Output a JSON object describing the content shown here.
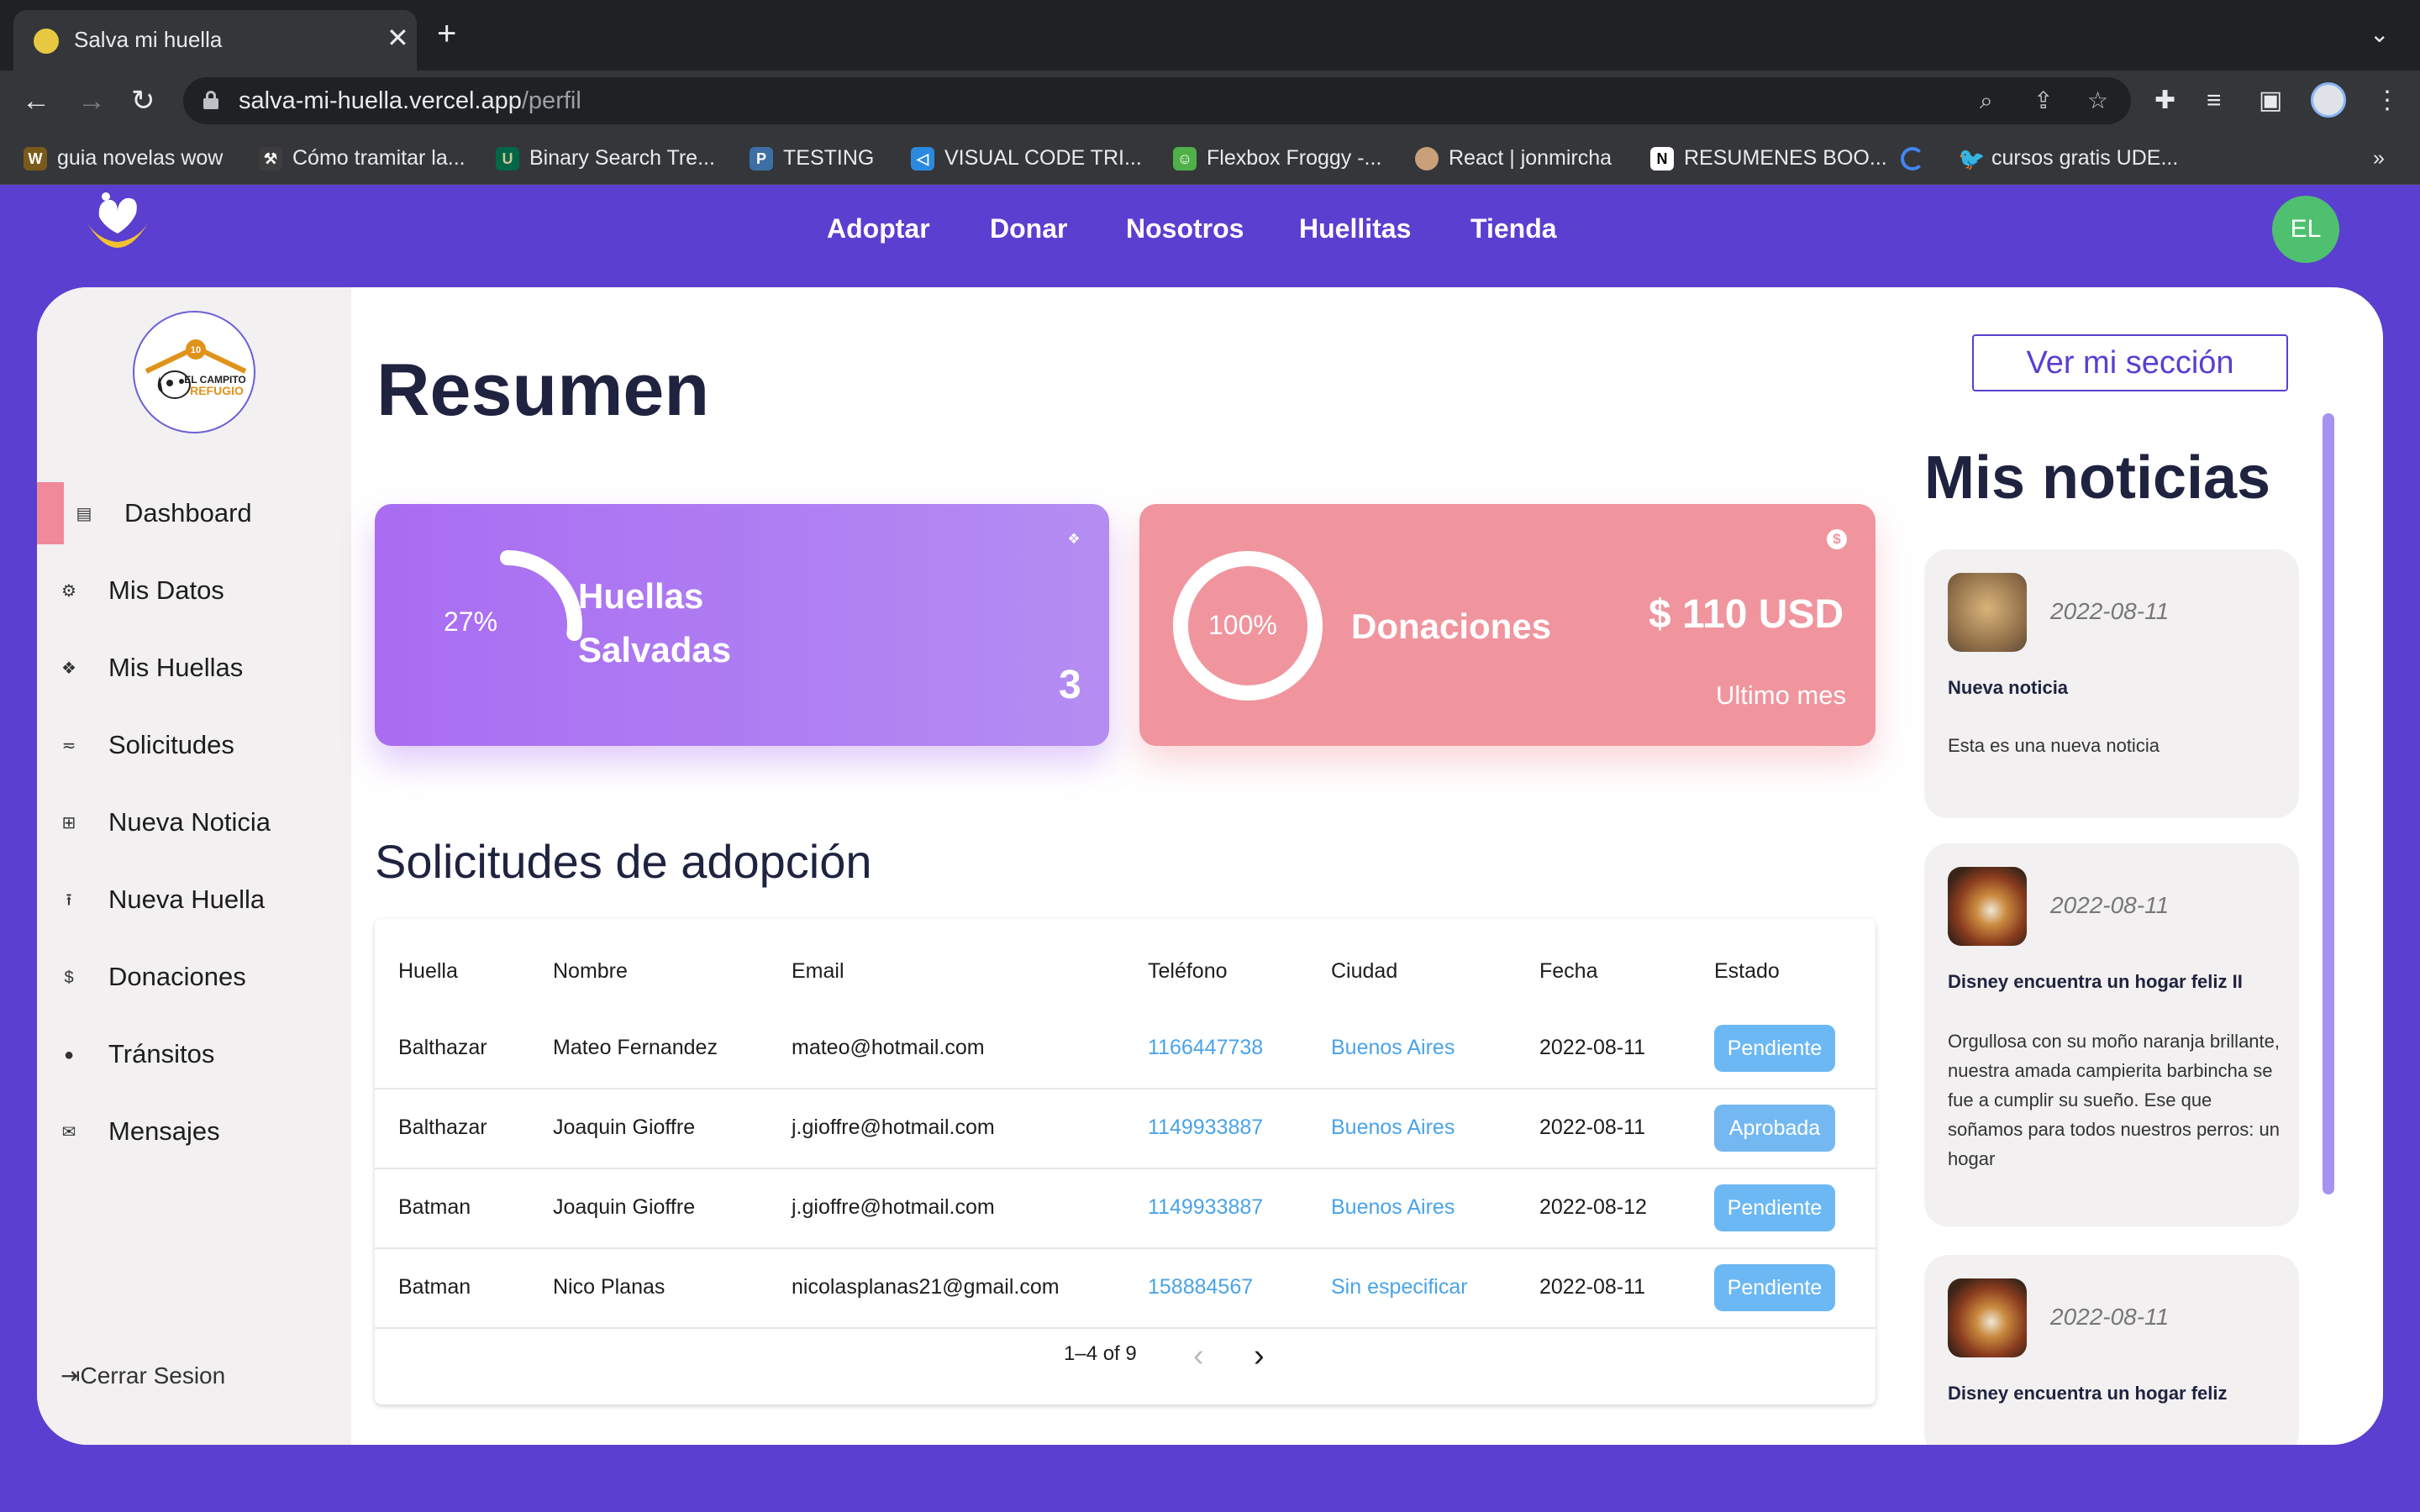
{
  "browser": {
    "tab_title": "Salva mi huella",
    "url_host": "salva-mi-huella.vercel.app",
    "url_path": "/perfil",
    "bookmarks": [
      {
        "label": "guia novelas wow",
        "icon": "wow-icon"
      },
      {
        "label": "Cómo tramitar la...",
        "icon": "hammer-icon"
      },
      {
        "label": "Binary Search Tre...",
        "icon": "usf-icon"
      },
      {
        "label": "TESTING",
        "icon": "python-icon"
      },
      {
        "label": "VISUAL CODE TRI...",
        "icon": "vscode-icon"
      },
      {
        "label": "Flexbox Froggy -...",
        "icon": "frog-icon"
      },
      {
        "label": "React | jonmircha",
        "icon": "avatar-icon"
      },
      {
        "label": "RESUMENES BOO...",
        "icon": "notion-icon"
      },
      {
        "label": "",
        "icon": "loading-icon"
      },
      {
        "label": "cursos gratis UDE...",
        "icon": "twitter-icon"
      }
    ]
  },
  "header": {
    "nav": [
      "Adoptar",
      "Donar",
      "Nosotros",
      "Huellitas",
      "Tienda"
    ],
    "user_initials": "EL",
    "colors": {
      "brand": "#5a3fd0",
      "avatar": "#4fc06f"
    }
  },
  "sidebar": {
    "org_logo": {
      "top": "10",
      "line1": "EL CAMPITO",
      "line2": "REFUGIO"
    },
    "items": [
      {
        "label": "Dashboard",
        "icon": "list-icon"
      },
      {
        "label": "Mis Datos",
        "icon": "gear-icon"
      },
      {
        "label": "Mis Huellas",
        "icon": "paw-icon"
      },
      {
        "label": "Solicitudes",
        "icon": "filter-icon"
      },
      {
        "label": "Nueva Noticia",
        "icon": "file-plus-icon"
      },
      {
        "label": "Nueva Huella",
        "icon": "upload-icon"
      },
      {
        "label": "Donaciones",
        "icon": "dollar-icon"
      },
      {
        "label": "Tránsitos",
        "icon": "person-icon"
      },
      {
        "label": "Mensajes",
        "icon": "mail-icon"
      }
    ],
    "active_index": 0,
    "logout": "Cerrar Sesion"
  },
  "main": {
    "title": "Resumen",
    "stats": {
      "huellas": {
        "percent": "27%",
        "progress": 0.27,
        "label_line1": "Huellas",
        "label_line2": "Salvadas",
        "value": "3",
        "color": "#a96cf2"
      },
      "donaciones": {
        "percent": "100%",
        "progress": 1.0,
        "label": "Donaciones",
        "value": "$ 110 USD",
        "sub": "Ultimo mes",
        "color": "#f0959e"
      }
    },
    "requests_title": "Solicitudes de adopción",
    "table": {
      "headers": [
        "Huella",
        "Nombre",
        "Email",
        "Teléfono",
        "Ciudad",
        "Fecha",
        "Estado"
      ],
      "rows": [
        [
          "Balthazar",
          "Mateo Fernandez",
          "mateo@hotmail.com",
          "1166447738",
          "Buenos Aires",
          "2022-08-11",
          "Pendiente"
        ],
        [
          "Balthazar",
          "Joaquin Gioffre",
          "j.gioffre@hotmail.com",
          "1149933887",
          "Buenos Aires",
          "2022-08-11",
          "Aprobada"
        ],
        [
          "Batman",
          "Joaquin Gioffre",
          "j.gioffre@hotmail.com",
          "1149933887",
          "Buenos Aires",
          "2022-08-12",
          "Pendiente"
        ],
        [
          "Batman",
          "Nico Planas",
          "nicolasplanas21@gmail.com",
          "158884567",
          "Sin especificar",
          "2022-08-11",
          "Pendiente"
        ]
      ],
      "pagination": "1–4 of 9"
    }
  },
  "news": {
    "button": "Ver mi sección",
    "title": "Mis noticias",
    "items": [
      {
        "date": "2022-08-11",
        "title": "Nueva noticia",
        "body": "Esta es una nueva noticia"
      },
      {
        "date": "2022-08-11",
        "title": "Disney encuentra un hogar feliz II",
        "body": "Orgullosa con su moño naranja brillante, nuestra amada campierita barbincha se fue a cumplir su sueño. Ese que soñamos para todos nuestros perros: un hogar"
      },
      {
        "date": "2022-08-11",
        "title": "Disney encuentra un hogar feliz",
        "body": ""
      }
    ]
  }
}
